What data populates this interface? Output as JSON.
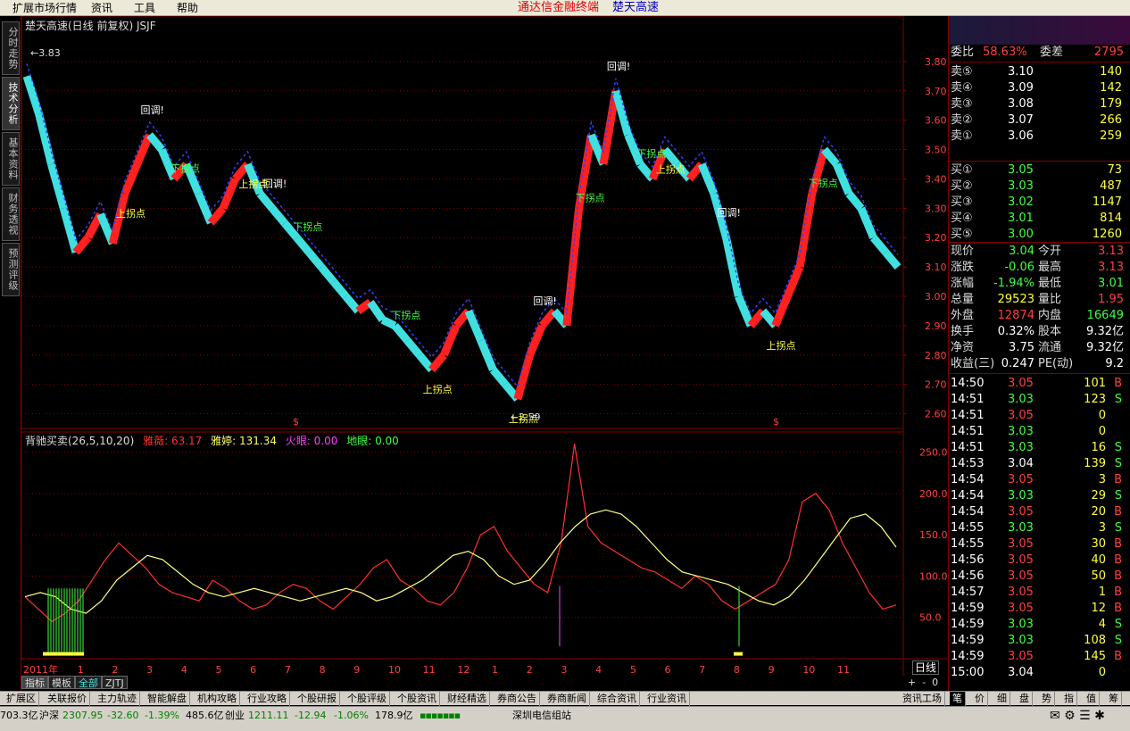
{
  "menubar": {
    "items": [
      "扩展市场行情",
      "资讯",
      "工具",
      "帮助"
    ],
    "app_title": "通达信金融终端",
    "stock_title": "楚天高速"
  },
  "lefttabs": [
    "分时走势",
    "技术分析",
    "基本资料",
    "财务透视",
    "预测评级"
  ],
  "chart_header": "楚天高速(日线 前复权) JSJF",
  "indicator_header": {
    "name": "背驰买卖(26,5,10,20)",
    "items": [
      {
        "label": "雅薇: 63.17",
        "color": "#ff3030"
      },
      {
        "label": "雅婷: 131.34",
        "color": "#ffff60"
      },
      {
        "label": "火眼: 0.00",
        "color": "#ff40ff"
      },
      {
        "label": "地眼: 0.00",
        "color": "#40ff40"
      }
    ]
  },
  "annotations": {
    "high_marker": "3.83",
    "low_marker": "2.59",
    "callback": "回调!",
    "up_turn": "上拐点",
    "down_turn": "下拐点",
    "dollar": "$"
  },
  "colors": {
    "up": "#ff2020",
    "down": "#40e0e0",
    "grid": "#800000",
    "axis_text": "#ff4040",
    "ma": "#ffff80",
    "green_label": "#40ff40",
    "white_label": "#ffffff",
    "yellow_label": "#ffff40"
  },
  "chart_data": [
    {
      "type": "line",
      "title": "楚天高速(日线 前复权)",
      "ylim": [
        2.55,
        3.9
      ],
      "y_ticks": [
        2.6,
        2.7,
        2.8,
        2.9,
        3.0,
        3.1,
        3.2,
        3.3,
        3.4,
        3.5,
        3.6,
        3.7,
        3.8
      ],
      "x_ticks": [
        "2011年",
        "1",
        "2",
        "3",
        "4",
        "5",
        "6",
        "7",
        "8",
        "9",
        "10",
        "11",
        "12",
        "1",
        "2",
        "3",
        "4",
        "5",
        "6",
        "7",
        "8",
        "9",
        "10",
        "11"
      ],
      "series": [
        {
          "values": [
            3.75,
            3.62,
            3.45,
            3.3,
            3.15,
            3.2,
            3.28,
            3.18,
            3.35,
            3.45,
            3.55,
            3.5,
            3.4,
            3.45,
            3.35,
            3.25,
            3.3,
            3.4,
            3.45,
            3.35,
            3.3,
            3.25,
            3.2,
            3.15,
            3.1,
            3.05,
            3.0,
            2.95,
            2.98,
            2.92,
            2.9,
            2.85,
            2.8,
            2.75,
            2.8,
            2.9,
            2.95,
            2.85,
            2.75,
            2.7,
            2.65,
            2.8,
            2.9,
            2.95,
            2.9,
            3.3,
            3.55,
            3.45,
            3.7,
            3.55,
            3.45,
            3.4,
            3.5,
            3.45,
            3.4,
            3.45,
            3.35,
            3.2,
            3.0,
            2.9,
            2.95,
            2.9,
            3.0,
            3.1,
            3.35,
            3.5,
            3.45,
            3.35,
            3.3,
            3.2,
            3.15,
            3.1
          ]
        }
      ]
    },
    {
      "type": "line",
      "title": "背驰买卖(26,5,10,20)",
      "ylim": [
        0,
        270
      ],
      "y_ticks": [
        50.0,
        100.0,
        150.0,
        200.0,
        250.0
      ],
      "series": [
        {
          "name": "雅薇",
          "values": [
            75,
            60,
            45,
            55,
            70,
            95,
            120,
            140,
            125,
            110,
            90,
            80,
            75,
            70,
            95,
            85,
            70,
            60,
            65,
            80,
            90,
            85,
            70,
            60,
            75,
            90,
            110,
            120,
            95,
            85,
            70,
            65,
            80,
            110,
            150,
            160,
            130,
            110,
            90,
            80,
            140,
            260,
            160,
            140,
            130,
            120,
            110,
            105,
            95,
            85,
            100,
            90,
            70,
            60,
            70,
            80,
            90,
            120,
            190,
            200,
            180,
            140,
            110,
            80,
            60,
            65
          ]
        },
        {
          "name": "雅婷",
          "values": [
            75,
            80,
            75,
            60,
            55,
            70,
            95,
            110,
            125,
            120,
            105,
            90,
            80,
            75,
            80,
            85,
            80,
            75,
            70,
            75,
            80,
            85,
            80,
            70,
            75,
            85,
            95,
            110,
            125,
            130,
            120,
            100,
            90,
            95,
            115,
            140,
            160,
            175,
            180,
            175,
            160,
            140,
            120,
            105,
            100,
            95,
            90,
            80,
            70,
            65,
            75,
            95,
            120,
            145,
            170,
            175,
            160,
            135
          ]
        }
      ]
    }
  ],
  "quote": {
    "top_row": [
      "委比",
      "58.63%",
      "委差",
      "2795"
    ],
    "sell": [
      {
        "label": "卖⑤",
        "price": "3.10",
        "vol": "140"
      },
      {
        "label": "卖④",
        "price": "3.09",
        "vol": "142"
      },
      {
        "label": "卖③",
        "price": "3.08",
        "vol": "179"
      },
      {
        "label": "卖②",
        "price": "3.07",
        "vol": "266"
      },
      {
        "label": "卖①",
        "price": "3.06",
        "vol": "259"
      }
    ],
    "buy": [
      {
        "label": "买①",
        "price": "3.05",
        "vol": "73"
      },
      {
        "label": "买②",
        "price": "3.03",
        "vol": "487"
      },
      {
        "label": "买③",
        "price": "3.02",
        "vol": "1147"
      },
      {
        "label": "买④",
        "price": "3.01",
        "vol": "814"
      },
      {
        "label": "买⑤",
        "price": "3.00",
        "vol": "1260"
      }
    ],
    "stats": [
      {
        "l1": "现价",
        "v1": "3.04",
        "c1": "#40ff40",
        "l2": "今开",
        "v2": "3.13",
        "c2": "#ff4040"
      },
      {
        "l1": "涨跌",
        "v1": "-0.06",
        "c1": "#40ff40",
        "l2": "最高",
        "v2": "3.13",
        "c2": "#ff4040"
      },
      {
        "l1": "涨幅",
        "v1": "-1.94%",
        "c1": "#40ff40",
        "l2": "最低",
        "v2": "3.01",
        "c2": "#40ff40"
      },
      {
        "l1": "总量",
        "v1": "29523",
        "c1": "#ffff40",
        "l2": "量比",
        "v2": "1.95",
        "c2": "#ff4040"
      },
      {
        "l1": "外盘",
        "v1": "12874",
        "c1": "#ff4040",
        "l2": "内盘",
        "v2": "16649",
        "c2": "#40ff40"
      },
      {
        "l1": "换手",
        "v1": "0.32%",
        "c1": "#ffffff",
        "l2": "股本",
        "v2": "9.32亿",
        "c2": "#ffffff"
      },
      {
        "l1": "净资",
        "v1": "3.75",
        "c1": "#ffffff",
        "l2": "流通",
        "v2": "9.32亿",
        "c2": "#ffffff"
      },
      {
        "l1": "收益(三)",
        "v1": "0.247",
        "c1": "#ffffff",
        "l2": "PE(动)",
        "v2": "9.2",
        "c2": "#ffffff"
      }
    ],
    "ticks": [
      {
        "t": "14:50",
        "p": "3.05",
        "v": "101",
        "s": "B"
      },
      {
        "t": "14:51",
        "p": "3.03",
        "v": "123",
        "s": "S"
      },
      {
        "t": "14:51",
        "p": "3.05",
        "v": "0",
        "s": ""
      },
      {
        "t": "14:51",
        "p": "3.03",
        "v": "0",
        "s": ""
      },
      {
        "t": "14:51",
        "p": "3.03",
        "v": "16",
        "s": "S"
      },
      {
        "t": "14:53",
        "p": "3.04",
        "v": "139",
        "s": "S"
      },
      {
        "t": "14:54",
        "p": "3.05",
        "v": "3",
        "s": "B"
      },
      {
        "t": "14:54",
        "p": "3.03",
        "v": "29",
        "s": "S"
      },
      {
        "t": "14:54",
        "p": "3.05",
        "v": "20",
        "s": "B"
      },
      {
        "t": "14:55",
        "p": "3.03",
        "v": "3",
        "s": "S"
      },
      {
        "t": "14:55",
        "p": "3.05",
        "v": "30",
        "s": "B"
      },
      {
        "t": "14:56",
        "p": "3.05",
        "v": "40",
        "s": "B"
      },
      {
        "t": "14:56",
        "p": "3.05",
        "v": "50",
        "s": "B"
      },
      {
        "t": "14:57",
        "p": "3.05",
        "v": "1",
        "s": "B"
      },
      {
        "t": "14:59",
        "p": "3.05",
        "v": "12",
        "s": "B"
      },
      {
        "t": "14:59",
        "p": "3.03",
        "v": "4",
        "s": "S"
      },
      {
        "t": "14:59",
        "p": "3.03",
        "v": "108",
        "s": "S"
      },
      {
        "t": "14:59",
        "p": "3.05",
        "v": "145",
        "s": "B"
      },
      {
        "t": "15:00",
        "p": "3.04",
        "v": "0",
        "s": ""
      }
    ]
  },
  "period_label": "日线",
  "small_tabs": [
    "指标",
    "模板",
    "全部",
    "ZJTJ"
  ],
  "bottom_tabs": [
    "扩展区",
    "关联报价",
    "主力轨迹",
    "智能解盘",
    "机构攻略",
    "行业攻略",
    "个股研报",
    "个股评级",
    "个股资讯",
    "财经精选",
    "券商公告",
    "券商新闻",
    "综合资讯",
    "行业资讯",
    "资讯工场"
  ],
  "right_tabs": [
    "笔",
    "价",
    "细",
    "盘",
    "势",
    "指",
    "值",
    "筹"
  ],
  "statusbar": {
    "items": [
      "703.3亿",
      "沪深",
      "2307.95",
      "-32.60",
      "-1.39%",
      "485.6亿",
      "创业",
      "1211.11",
      "-12.94",
      "-1.06%",
      "178.9亿",
      "深圳电信组站"
    ]
  }
}
